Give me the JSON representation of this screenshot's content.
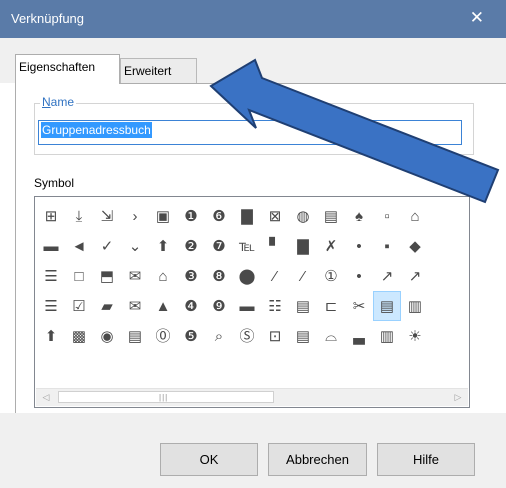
{
  "window": {
    "title": "Verknüpfung",
    "close_glyph": "✕"
  },
  "tabs": [
    {
      "label": "Eigenschaften",
      "active": true
    },
    {
      "label": "Erweitert",
      "active": false
    }
  ],
  "name_group": {
    "legend_first": "N",
    "legend_rest": "ame",
    "value": "Gruppenadressbuch"
  },
  "symbol": {
    "label": "Symbol",
    "selected_index": 54,
    "icons": [
      "⊞",
      "⤓",
      "⇲",
      "›",
      "▣",
      "❶",
      "❻",
      "▇",
      "⊠",
      "◍",
      "▤",
      "♠",
      "▫",
      "⌂",
      "▬",
      "◄",
      "✓",
      "⌄",
      "⬆",
      "❷",
      "❼",
      "℡",
      "▘",
      "▇",
      "✗",
      "•",
      "▪",
      "◆",
      "☰",
      "□",
      "⬒",
      "✉",
      "⌂",
      "❸",
      "❽",
      "⬤",
      "⁄",
      "⁄",
      "①",
      "•",
      "↗",
      "↗",
      "☰",
      "☑",
      "▰",
      "✉",
      "▲",
      "❹",
      "❾",
      "▬",
      "☷",
      "▤",
      "⊏",
      "✂",
      "▤",
      "▥",
      "⬆",
      "▩",
      "◉",
      "▤",
      "⓪",
      "❺",
      "⌕",
      "Ⓢ",
      "⊡",
      "▤",
      "⌓",
      "▃",
      "▥",
      "☀"
    ],
    "scroll_left": "◁",
    "scroll_right": "▷",
    "scroll_grip": "|||"
  },
  "buttons": {
    "ok": "OK",
    "cancel": "Abbrechen",
    "help": "Hilfe"
  },
  "colors": {
    "titlebar": "#5a7ba8",
    "annotation_arrow": "#3a72c4",
    "annotation_outline": "#1f3f73"
  }
}
